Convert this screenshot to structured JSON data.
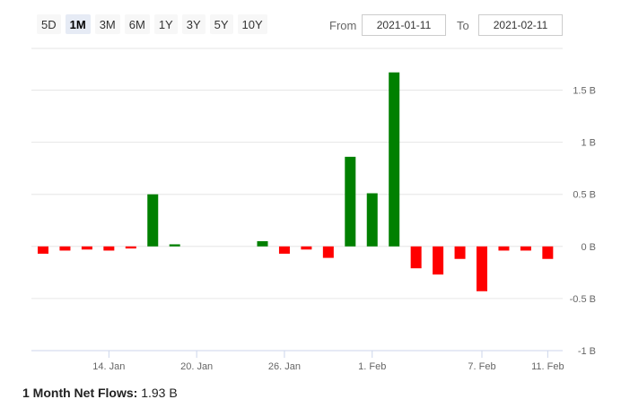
{
  "range_selector": {
    "buttons": [
      "5D",
      "1M",
      "3M",
      "6M",
      "1Y",
      "3Y",
      "5Y",
      "10Y"
    ],
    "active": "1M"
  },
  "date_range": {
    "from_label": "From",
    "from_value": "2021-01-11",
    "to_label": "To",
    "to_value": "2021-02-11"
  },
  "colors": {
    "positive": "#008000",
    "negative": "#ff0000"
  },
  "chart_data": {
    "type": "bar",
    "title": "",
    "xlabel": "",
    "ylabel": "",
    "ylim": [
      -1,
      1.9
    ],
    "y_ticks": [
      {
        "value": 1.5,
        "label": "1.5 B"
      },
      {
        "value": 1,
        "label": "1 B"
      },
      {
        "value": 0.5,
        "label": "0.5 B"
      },
      {
        "value": 0,
        "label": "0 B"
      },
      {
        "value": -0.5,
        "label": "-0.5 B"
      },
      {
        "value": -1,
        "label": "-1 B"
      }
    ],
    "x_ticks": [
      {
        "date": "2021-01-14",
        "label": "14. Jan"
      },
      {
        "date": "2021-01-20",
        "label": "20. Jan"
      },
      {
        "date": "2021-01-26",
        "label": "26. Jan"
      },
      {
        "date": "2021-02-01",
        "label": "1. Feb"
      },
      {
        "date": "2021-02-07",
        "label": "7. Feb"
      },
      {
        "date": "2021-02-11",
        "label": "11. Feb"
      }
    ],
    "grid": true,
    "x": [
      "2021-01-11",
      "2021-01-12",
      "2021-01-13",
      "2021-01-14",
      "2021-01-15",
      "2021-01-18",
      "2021-01-19",
      "2021-01-20",
      "2021-01-21",
      "2021-01-22",
      "2021-01-25",
      "2021-01-26",
      "2021-01-27",
      "2021-01-28",
      "2021-01-29",
      "2021-02-01",
      "2021-02-02",
      "2021-02-03",
      "2021-02-04",
      "2021-02-05",
      "2021-02-08",
      "2021-02-09",
      "2021-02-10",
      "2021-02-11"
    ],
    "values": [
      -0.07,
      -0.04,
      -0.03,
      -0.04,
      -0.02,
      0.5,
      0.02,
      0,
      0,
      0,
      0.05,
      -0.07,
      -0.03,
      -0.11,
      0.86,
      0.51,
      1.67,
      -0.21,
      -0.27,
      -0.12,
      -0.43,
      -0.04,
      -0.04,
      -0.12
    ]
  },
  "summary": {
    "label": "1 Month Net Flows:",
    "value": "1.93 B"
  }
}
